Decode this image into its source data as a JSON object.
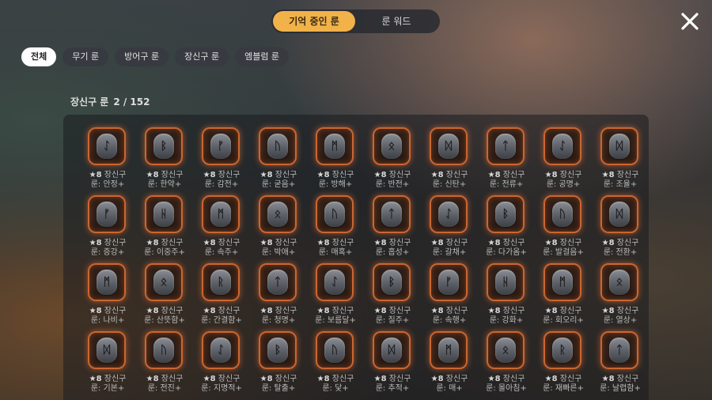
{
  "tabs": {
    "active": "기억 중인 룬",
    "second": "룬 워드"
  },
  "filters": [
    "전체",
    "무기 룬",
    "방어구 룬",
    "장신구 룬",
    "엠블럼 룬"
  ],
  "count": {
    "label": "장신구 룬",
    "value": "2 / 152"
  },
  "icons": {
    "close": "close-icon",
    "rune": "rune-stone-icon"
  },
  "colors": {
    "accent": "#f1b24a",
    "frame": "#c96632"
  },
  "runes": [
    {
      "glyph": "ᛇ",
      "grade": "★8",
      "type": "장신구",
      "name": "룬: 안정+"
    },
    {
      "glyph": "ᛒ",
      "grade": "★8",
      "type": "장신구",
      "name": "룬: 한약+"
    },
    {
      "glyph": "ᚠ",
      "grade": "★8",
      "type": "장신구",
      "name": "룬: 감전+"
    },
    {
      "glyph": "ᚢ",
      "grade": "★8",
      "type": "장신구",
      "name": "룬: 굳음+"
    },
    {
      "glyph": "ᛗ",
      "grade": "★8",
      "type": "장신구",
      "name": "룬: 방해+"
    },
    {
      "glyph": "ᛟ",
      "grade": "★8",
      "type": "장신구",
      "name": "룬: 반전+"
    },
    {
      "glyph": "ᛞ",
      "grade": "★8",
      "type": "장신구",
      "name": "룬: 신탄+"
    },
    {
      "glyph": "ᛏ",
      "grade": "★8",
      "type": "장신구",
      "name": "룬: 전류+"
    },
    {
      "glyph": "ᛇ",
      "grade": "★8",
      "type": "장신구",
      "name": "룬: 공명+"
    },
    {
      "glyph": "ᛞ",
      "grade": "★8",
      "type": "장신구",
      "name": "룬: 조율+"
    },
    {
      "glyph": "ᚠ",
      "grade": "★8",
      "type": "장신구",
      "name": "룬: 증강+"
    },
    {
      "glyph": "ᚺ",
      "grade": "★8",
      "type": "장신구",
      "name": "룬: 이중주+"
    },
    {
      "glyph": "ᛗ",
      "grade": "★8",
      "type": "장신구",
      "name": "룬: 속주+"
    },
    {
      "glyph": "ᛟ",
      "grade": "★8",
      "type": "장신구",
      "name": "룬: 박애+"
    },
    {
      "glyph": "ᚢ",
      "grade": "★8",
      "type": "장신구",
      "name": "룬: 매혹+"
    },
    {
      "glyph": "ᛏ",
      "grade": "★8",
      "type": "장신구",
      "name": "룬: 흡성+"
    },
    {
      "glyph": "ᛇ",
      "grade": "★8",
      "type": "장신구",
      "name": "룬: 갈채+"
    },
    {
      "glyph": "ᛒ",
      "grade": "★8",
      "type": "장신구",
      "name": "룬: 다가옴+"
    },
    {
      "glyph": "ᚢ",
      "grade": "★8",
      "type": "장신구",
      "name": "룬: 발걸음+"
    },
    {
      "glyph": "ᛞ",
      "grade": "★8",
      "type": "장신구",
      "name": "룬: 전환+"
    },
    {
      "glyph": "ᛗ",
      "grade": "★8",
      "type": "장신구",
      "name": "룬: 나비+"
    },
    {
      "glyph": "ᛟ",
      "grade": "★8",
      "type": "장신구",
      "name": "룬: 산뜻함+"
    },
    {
      "glyph": "ᚱ",
      "grade": "★8",
      "type": "장신구",
      "name": "룬: 간결함+"
    },
    {
      "glyph": "ᛏ",
      "grade": "★8",
      "type": "장신구",
      "name": "룬: 청명+"
    },
    {
      "glyph": "ᛇ",
      "grade": "★8",
      "type": "장신구",
      "name": "룬: 보름달+"
    },
    {
      "glyph": "ᛒ",
      "grade": "★8",
      "type": "장신구",
      "name": "룬: 질주+"
    },
    {
      "glyph": "ᚠ",
      "grade": "★8",
      "type": "장신구",
      "name": "룬: 속행+"
    },
    {
      "glyph": "ᚺ",
      "grade": "★8",
      "type": "장신구",
      "name": "룬: 강화+"
    },
    {
      "glyph": "ᛗ",
      "grade": "★8",
      "type": "장신구",
      "name": "룬: 회오리+"
    },
    {
      "glyph": "ᛟ",
      "grade": "★8",
      "type": "장신구",
      "name": "룬: 열상+"
    },
    {
      "glyph": "ᛞ",
      "grade": "★8",
      "type": "장신구",
      "name": "룬: 기본+"
    },
    {
      "glyph": "ᚢ",
      "grade": "★8",
      "type": "장신구",
      "name": "룬: 전진+"
    },
    {
      "glyph": "ᛇ",
      "grade": "★8",
      "type": "장신구",
      "name": "룬: 지명적+"
    },
    {
      "glyph": "ᛒ",
      "grade": "★8",
      "type": "장신구",
      "name": "룬: 탈출+"
    },
    {
      "glyph": "ᚢ",
      "grade": "★8",
      "type": "장신구",
      "name": "룬: 닻+"
    },
    {
      "glyph": "ᛞ",
      "grade": "★8",
      "type": "장신구",
      "name": "룬: 추적+"
    },
    {
      "glyph": "ᛗ",
      "grade": "★8",
      "type": "장신구",
      "name": "룬: 매+"
    },
    {
      "glyph": "ᛟ",
      "grade": "★8",
      "type": "장신구",
      "name": "룬: 몰아침+"
    },
    {
      "glyph": "ᚱ",
      "grade": "★8",
      "type": "장신구",
      "name": "룬: 재빠른+"
    },
    {
      "glyph": "ᛏ",
      "grade": "★8",
      "type": "장신구",
      "name": "룬: 날렵함+"
    }
  ]
}
